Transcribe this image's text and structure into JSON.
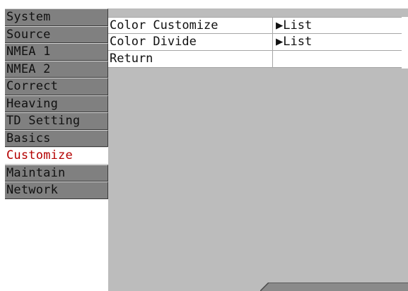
{
  "sidebar": {
    "items": [
      {
        "label": "System"
      },
      {
        "label": "Source"
      },
      {
        "label": "NMEA 1"
      },
      {
        "label": "NMEA 2"
      },
      {
        "label": "Correct"
      },
      {
        "label": "Heaving"
      },
      {
        "label": "TD Setting"
      },
      {
        "label": "Basics"
      },
      {
        "label": "Customize"
      },
      {
        "label": "Maintain"
      },
      {
        "label": "Network"
      }
    ],
    "active": "Customize"
  },
  "submenu": {
    "rows": [
      {
        "label": "Color Customize",
        "value": "▶List"
      },
      {
        "label": "Color Divide",
        "value": "▶List"
      },
      {
        "label": "Return",
        "value": ""
      }
    ]
  },
  "colors": {
    "menu_bg": "#808080",
    "active_text": "#b40000",
    "panel_bg": "#bcbcbc"
  }
}
